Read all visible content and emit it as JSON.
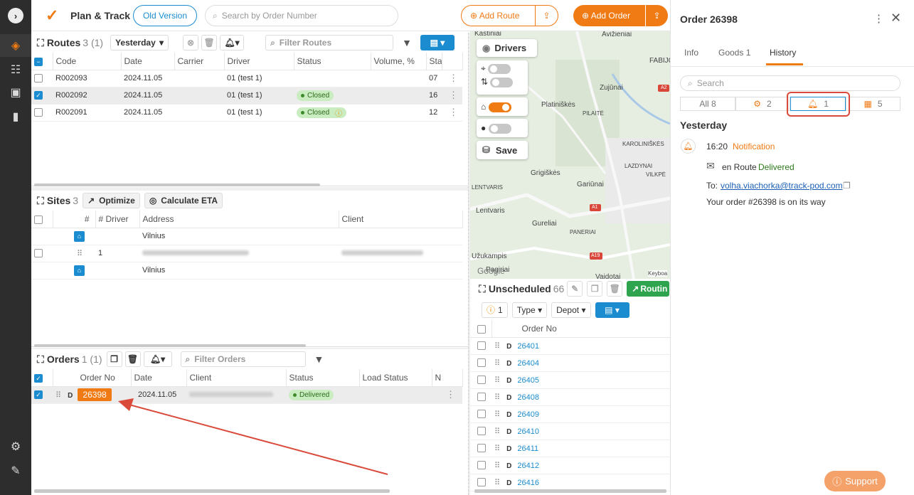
{
  "app": {
    "title": "Plan & Track",
    "old_version": "Old Version",
    "search_placeholder": "Search by Order Number",
    "add_route": "Add Route",
    "add_order": "Add Order"
  },
  "sidebar": {
    "items": [
      "chevron-right-icon",
      "route-icon",
      "checklist-icon",
      "badge-icon",
      "bar-chart-icon",
      "gear-icon",
      "book-icon"
    ]
  },
  "routes": {
    "title": "Routes",
    "count": "3 (1)",
    "period": "Yesterday",
    "filter_placeholder": "Filter Routes",
    "columns": [
      "Code",
      "Date",
      "Carrier",
      "Driver",
      "Status",
      "Volume, %",
      "Sta"
    ],
    "rows": [
      {
        "code": "R002093",
        "date": "2024.11.05",
        "carrier": "",
        "driver": "01 (test 1)",
        "status": "",
        "extra": "07",
        "checked": false
      },
      {
        "code": "R002092",
        "date": "2024.11.05",
        "carrier": "",
        "driver": "01 (test 1)",
        "status": "Closed",
        "extra": "16",
        "checked": true
      },
      {
        "code": "R002091",
        "date": "2024.11.05",
        "carrier": "",
        "driver": "01 (test 1)",
        "status": "Closed",
        "extra": "12",
        "checked": false
      }
    ]
  },
  "sites": {
    "title": "Sites",
    "count": "3",
    "optimize": "Optimize",
    "calc_eta": "Calculate ETA",
    "columns": [
      "#",
      "# Driver",
      "Address",
      "Client"
    ],
    "rows": [
      {
        "num": "",
        "address": "Vilnius"
      },
      {
        "num": "1",
        "address": ""
      },
      {
        "num": "",
        "address": "Vilnius"
      }
    ]
  },
  "orders": {
    "title": "Orders",
    "count": "1 (1)",
    "filter_placeholder": "Filter Orders",
    "columns": [
      "Order No",
      "Date",
      "Client",
      "Status",
      "Load Status",
      "N"
    ],
    "rows": [
      {
        "type": "D",
        "order_no": "26398",
        "date": "2024.11.05",
        "status": "Delivered"
      }
    ]
  },
  "map": {
    "drivers": "Drivers",
    "save": "Save",
    "places": [
      "Kastiniai",
      "Avižieniai",
      "Zujūnai",
      "Platiniškės",
      "PILAITĖ",
      "KAROLINIŠKĖS",
      "LAZDYNAI",
      "Grigiškės",
      "VILKPĖ",
      "LENTVARIS",
      "Gariūnai",
      "Lentvaris",
      "A1",
      "Gureliai",
      "PANERIAI",
      "Užukampis",
      "A19",
      "Pagiriai",
      "Vaidotai",
      "FABIJONIŠKĖS",
      "A2"
    ],
    "google": "Google",
    "keyboard": "Keyboa"
  },
  "unscheduled": {
    "title": "Unscheduled",
    "count": "66",
    "routing": "Routin",
    "warn_count": "1",
    "type": "Type",
    "depot": "Depot",
    "column": "Order No",
    "rows": [
      "26401",
      "26404",
      "26405",
      "26408",
      "26409",
      "26410",
      "26411",
      "26412",
      "26416"
    ],
    "row_type": "D"
  },
  "order_panel": {
    "title": "Order 26398",
    "tabs": [
      "Info",
      "Goods 1",
      "History"
    ],
    "active_tab": "History",
    "search_placeholder": "Search",
    "filters": [
      {
        "label": "All 8"
      },
      {
        "label": "2"
      },
      {
        "label": "1"
      },
      {
        "label": "5"
      }
    ],
    "day": "Yesterday",
    "event": {
      "time": "16:20",
      "type": "Notification",
      "channel_prefix": "en Route",
      "channel_status": "Delivered",
      "to_label": "To:",
      "email": "volha.viachorka@track-pod.com",
      "message": "Your order #26398 is on its way"
    },
    "support": "Support"
  },
  "colors": {
    "accent": "#f07a14",
    "blue": "#1a8ccf",
    "sidebar": "#2d2d2d",
    "annotation": "#d94a3a"
  }
}
